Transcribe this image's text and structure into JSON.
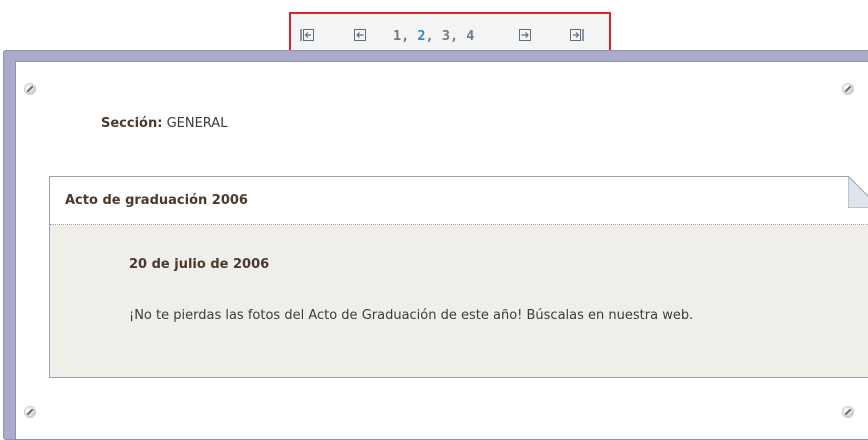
{
  "pager": {
    "first_icon": "first-page-icon",
    "prev_icon": "previous-page-icon",
    "next_icon": "next-page-icon",
    "last_icon": "last-page-icon",
    "pages": [
      "1",
      "2",
      "3",
      "4"
    ],
    "separator": ", ",
    "current_page": "2",
    "highlight_color": "#e0202a",
    "current_color": "#2f8ec0"
  },
  "section": {
    "label": "Sección:",
    "value": "GENERAL"
  },
  "news": {
    "title": "Acto de graduación 2006",
    "date": "20 de julio de 2006",
    "body": "¡No te pierdas las fotos del Acto de Graduación de este año! Búscalas en nuestra web."
  },
  "decor": {
    "screw_icon": "screw-icon",
    "corner_icon": "folded-corner-icon"
  }
}
